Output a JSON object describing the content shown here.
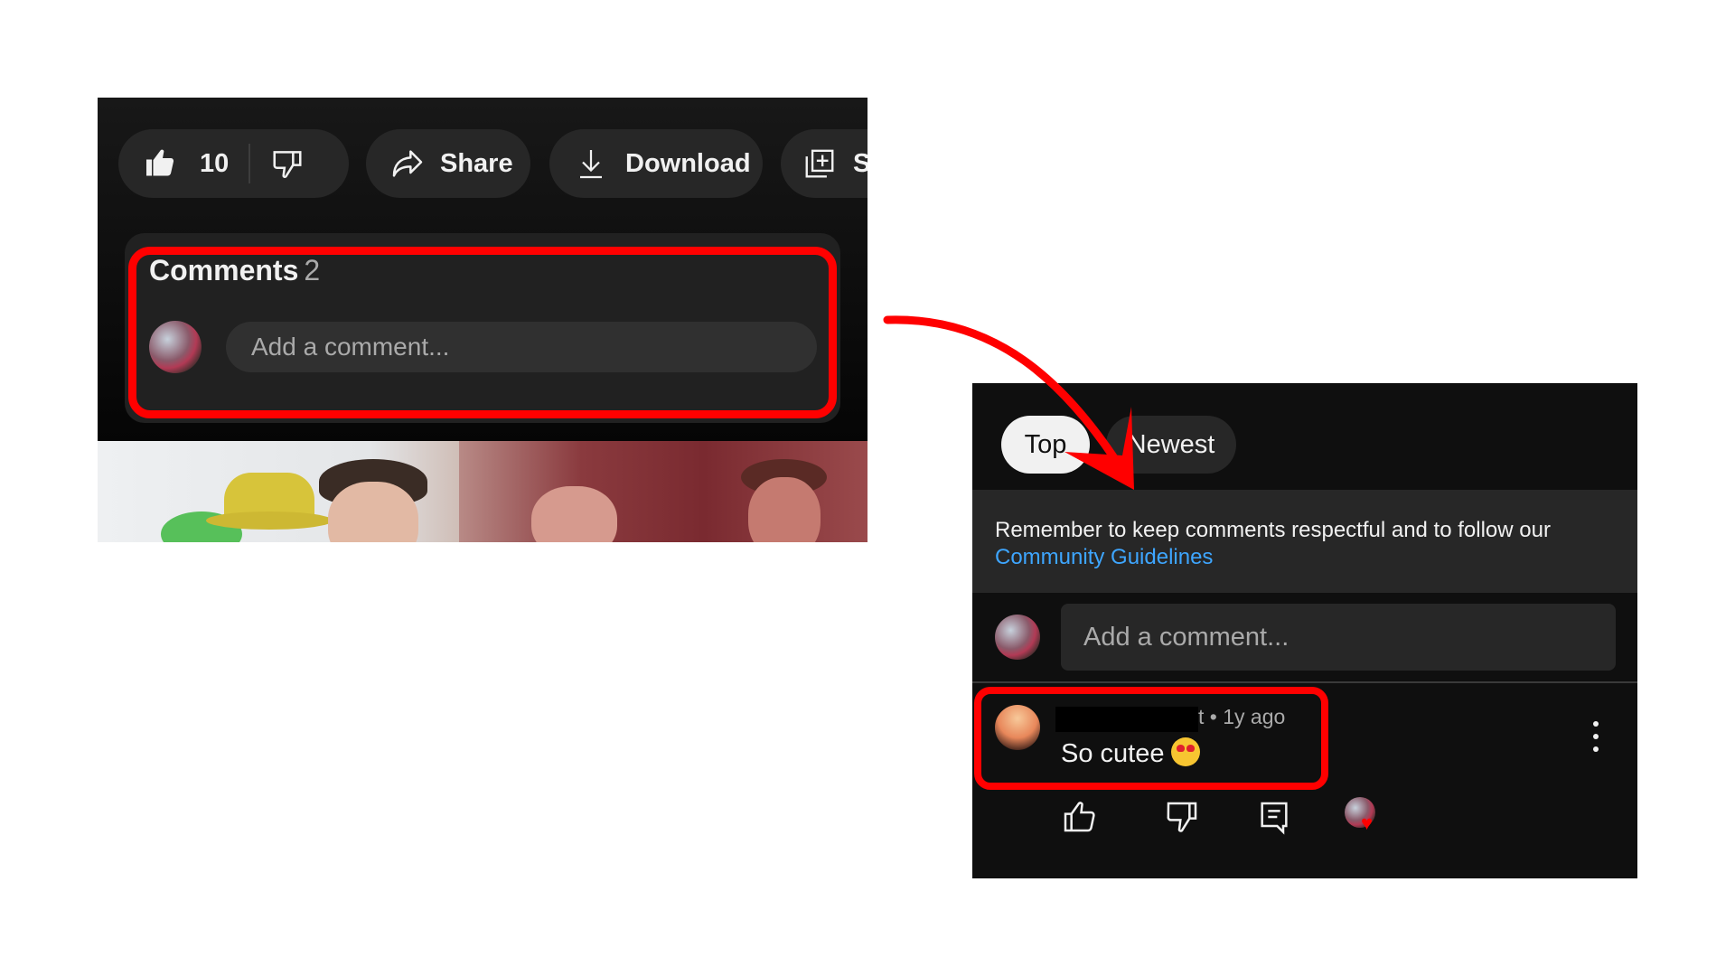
{
  "left_panel": {
    "like_count": "10",
    "buttons": {
      "share_label": "Share",
      "download_label": "Download",
      "save_label_partial": "S"
    },
    "comments": {
      "title": "Comments",
      "count": "2",
      "input_placeholder": "Add a comment..."
    }
  },
  "right_panel": {
    "sort_chips": [
      {
        "label": "Top",
        "selected": true
      },
      {
        "label": "Newest",
        "selected": false
      }
    ],
    "notice": {
      "text": "Remember to keep comments respectful and to follow our",
      "link_label": "Community Guidelines"
    },
    "input_placeholder": "Add a comment...",
    "comment": {
      "author": "[redacted]",
      "author_visible_tail": "t",
      "time": "• 1y ago",
      "text": "So cutee",
      "emoji": "heart-eyes-emoji"
    }
  },
  "annotation": {
    "highlight_color": "#ff0000",
    "arrow_color": "#ff0000"
  },
  "colors": {
    "panel_bg": "#0f0f0f",
    "button_bg": "#272727",
    "link": "#3ea6ff",
    "text_primary": "#f1f1f1",
    "text_secondary": "#aaaaaa"
  }
}
